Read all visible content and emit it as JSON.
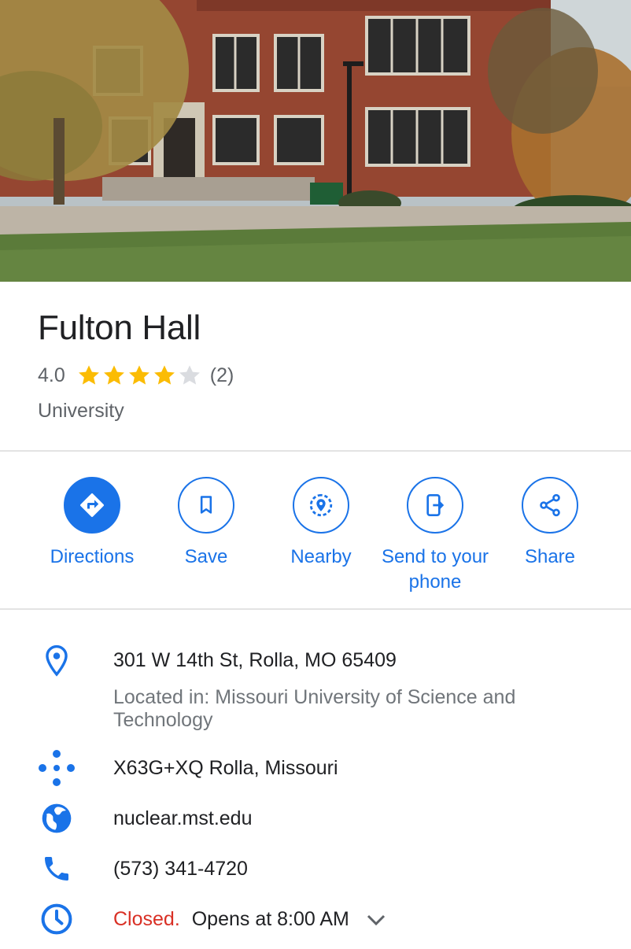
{
  "place": {
    "name": "Fulton Hall",
    "rating": "4.0",
    "stars_filled": 4,
    "stars_total": 5,
    "review_count": "(2)",
    "category": "University"
  },
  "actions": [
    {
      "label": "Directions",
      "icon": "directions-icon",
      "filled": true
    },
    {
      "label": "Save",
      "icon": "bookmark-icon",
      "filled": false
    },
    {
      "label": "Nearby",
      "icon": "nearby-icon",
      "filled": false
    },
    {
      "label": "Send to your phone",
      "icon": "send-to-phone-icon",
      "filled": false
    },
    {
      "label": "Share",
      "icon": "share-icon",
      "filled": false
    }
  ],
  "details": {
    "address": "301 W 14th St, Rolla, MO 65409",
    "located_in": "Located in: Missouri University of Science and Technology",
    "plus_code": "X63G+XQ Rolla, Missouri",
    "website": "nuclear.mst.edu",
    "phone": "(573) 341-4720",
    "hours_status": "Closed.",
    "hours_next": "Opens at 8:00 AM"
  },
  "colors": {
    "accent": "#1a73e8",
    "star": "#fbbc04",
    "closed": "#d93025"
  }
}
